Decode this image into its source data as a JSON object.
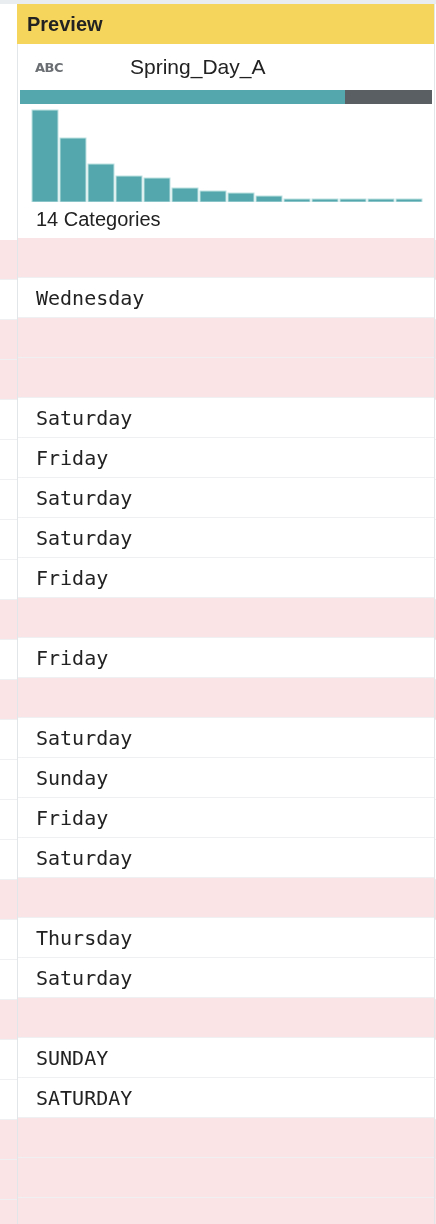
{
  "header": {
    "title": "Preview"
  },
  "column": {
    "type_label": "ABC",
    "name": "Spring_Day_A",
    "quality": {
      "level": 0.79
    },
    "summary": "14 Categories"
  },
  "rows": [
    {
      "value": null,
      "missing": true
    },
    {
      "value": "Wednesday",
      "missing": false
    },
    {
      "value": null,
      "missing": true
    },
    {
      "value": null,
      "missing": true
    },
    {
      "value": "Saturday",
      "missing": false
    },
    {
      "value": "Friday",
      "missing": false
    },
    {
      "value": "Saturday",
      "missing": false
    },
    {
      "value": "Saturday",
      "missing": false
    },
    {
      "value": "Friday",
      "missing": false
    },
    {
      "value": null,
      "missing": true
    },
    {
      "value": "Friday",
      "missing": false
    },
    {
      "value": null,
      "missing": true
    },
    {
      "value": "Saturday",
      "missing": false
    },
    {
      "value": "Sunday",
      "missing": false
    },
    {
      "value": "Friday",
      "missing": false
    },
    {
      "value": "Saturday",
      "missing": false
    },
    {
      "value": null,
      "missing": true
    },
    {
      "value": "Thursday",
      "missing": false
    },
    {
      "value": "Saturday",
      "missing": false
    },
    {
      "value": null,
      "missing": true
    },
    {
      "value": "SUNDAY",
      "missing": false
    },
    {
      "value": "SATURDAY",
      "missing": false
    },
    {
      "value": null,
      "missing": true
    },
    {
      "value": null,
      "missing": true
    },
    {
      "value": null,
      "missing": true
    }
  ]
}
